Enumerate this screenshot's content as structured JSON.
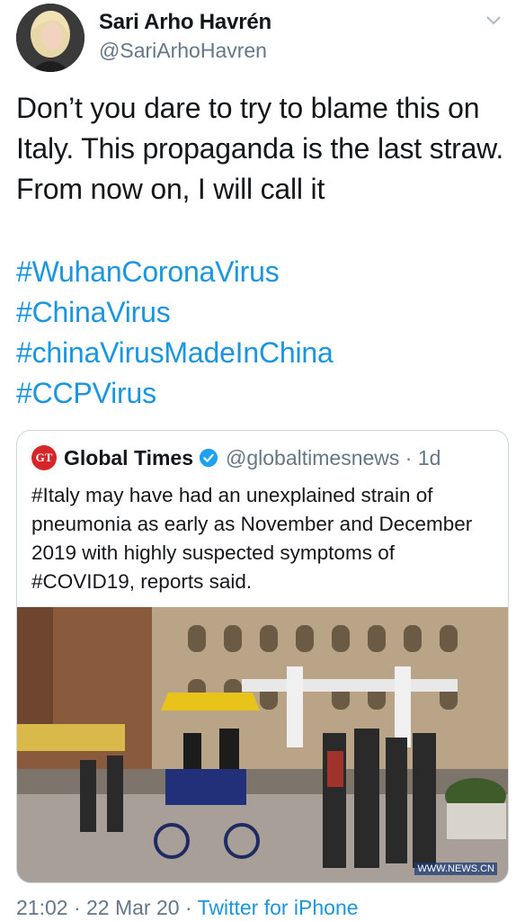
{
  "author": {
    "display_name": "Sari Arho Havrén",
    "handle": "@SariArhoHavren"
  },
  "tweet": {
    "text": "Don’t you dare to try to blame this on Italy. This propaganda is the last straw. From now on, I will call it",
    "hashtags": [
      "#WuhanCoronaVirus",
      "#ChinaVirus",
      "#chinaVirusMadeInChina",
      "#CCPVirus"
    ]
  },
  "quoted": {
    "logo": "GT",
    "name": "Global Times",
    "handle_time": "@globaltimesnews · 1d",
    "text": "#Italy may have had an unexplained strain of pneumonia as early as November and December 2019 with highly suspected symptoms of #COVID19, reports said.",
    "image_watermark": "WWW.NEWS.CN"
  },
  "meta": {
    "time": "21:02 · 22 Mar 20 · ",
    "source": "Twitter for iPhone"
  },
  "colors": {
    "link": "#1b95e0",
    "secondary": "#657786",
    "border": "#ccd6dd",
    "verified": "#1da1f2",
    "gt_red": "#d7262a"
  },
  "icons": [
    "chevron-down-icon",
    "verified-badge-icon"
  ]
}
